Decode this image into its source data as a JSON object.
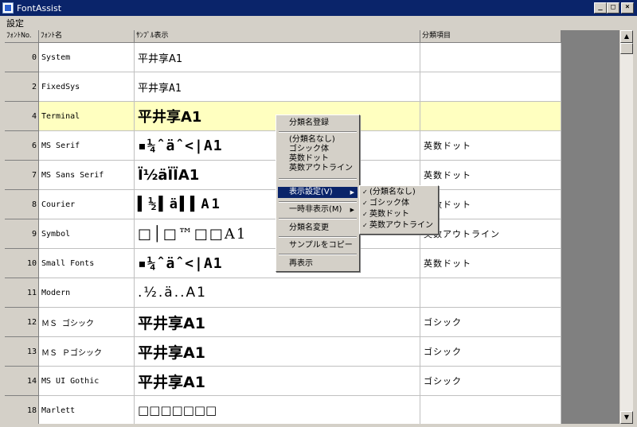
{
  "window": {
    "title": "FontAssist",
    "btn_min": "_",
    "btn_max": "□",
    "btn_close": "×"
  },
  "menu": {
    "settings": "設定"
  },
  "grid": {
    "headers": [
      "ﾌｫﾝﾄNo.",
      "ﾌｫﾝﾄ名",
      "ｻﾝﾌﾟﾙ表示",
      "分類項目"
    ],
    "rows": [
      {
        "no": "0",
        "name": "System",
        "sample": "平井享A1",
        "category": ""
      },
      {
        "no": "2",
        "name": "FixedSys",
        "sample": "平井享A1",
        "category": ""
      },
      {
        "no": "4",
        "name": "Terminal",
        "sample": "平井享A1",
        "category": ""
      },
      {
        "no": "6",
        "name": "MS Serif",
        "sample": "▪¼ˆäˆ<|A1",
        "category": "英数ドット"
      },
      {
        "no": "7",
        "name": "MS Sans Serif",
        "sample": "Ï½äÏÏA1",
        "category": "英数ドット"
      },
      {
        "no": "8",
        "name": "Courier",
        "sample": "▌½▌ä▌▌A1",
        "category": "英数ドット"
      },
      {
        "no": "9",
        "name": "Symbol",
        "sample": "□│□™□□A1",
        "category": "英数アウトライン"
      },
      {
        "no": "10",
        "name": "Small Fonts",
        "sample": "▪¼ˆäˆ<|A1",
        "category": "英数ドット"
      },
      {
        "no": "11",
        "name": "Modern",
        "sample": ".½.ä..A1",
        "category": ""
      },
      {
        "no": "12",
        "name": "ＭＳ ゴシック",
        "sample": "平井享A1",
        "category": "ゴシック"
      },
      {
        "no": "13",
        "name": "ＭＳ Ｐゴシック",
        "sample": "平井享A1",
        "category": "ゴシック"
      },
      {
        "no": "14",
        "name": "MS UI Gothic",
        "sample": "平井享A1",
        "category": "ゴシック"
      },
      {
        "no": "18",
        "name": "Marlett",
        "sample": "□□□□□□□",
        "category": ""
      }
    ]
  },
  "context_menu": {
    "register": "分類名登録",
    "none": "(分類名なし)",
    "gothic": "ゴシック体",
    "eisu_dot": "英数ドット",
    "eisu_outline": "英数アウトライン",
    "display_settings": "表示設定(V)",
    "temp_hide": "一時非表示(M)",
    "rename": "分類名変更",
    "copy_sample": "サンプルをコピー",
    "redisplay": "再表示"
  },
  "submenu": {
    "none": "(分類名なし)",
    "gothic": "ゴシック体",
    "eisu_dot": "英数ドット",
    "eisu_outline": "英数アウトライン"
  },
  "colors": {
    "highlight_row": "#ffffc0",
    "menu_active": "#0a246a",
    "title_bar": "#0a246a"
  }
}
